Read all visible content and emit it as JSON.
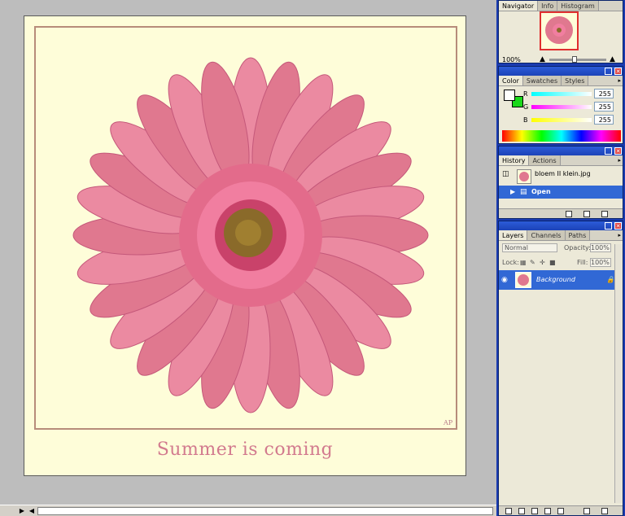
{
  "document": {
    "caption": "Summer is coming",
    "signature": "AP"
  },
  "colors": {
    "canvas_bg": "#fefdd9",
    "frame_border": "#b78c7a",
    "caption_color": "#d27a8e",
    "petal_pink": "#e0788f",
    "selection_blue": "#3168d5"
  },
  "navigator": {
    "tabs": [
      "Navigator",
      "Info",
      "Histogram"
    ],
    "zoom": "100%"
  },
  "color_palette": {
    "tabs": [
      "Color",
      "Swatches",
      "Styles"
    ],
    "channels": [
      {
        "label": "R",
        "value": "255"
      },
      {
        "label": "G",
        "value": "255"
      },
      {
        "label": "B",
        "value": "255"
      }
    ],
    "foreground_color": "#ffffff",
    "background_color": "#1ad81a"
  },
  "history": {
    "tabs": [
      "History",
      "Actions"
    ],
    "snapshot": "bloem II klein.jpg",
    "steps": [
      "Open"
    ]
  },
  "layers": {
    "tabs": [
      "Layers",
      "Channels",
      "Paths"
    ],
    "blend_mode": "Normal",
    "opacity_label": "Opacity:",
    "opacity_value": "100%",
    "lock_label": "Lock:",
    "fill_label": "Fill:",
    "fill_value": "100%",
    "items": [
      {
        "name": "Background"
      }
    ]
  }
}
